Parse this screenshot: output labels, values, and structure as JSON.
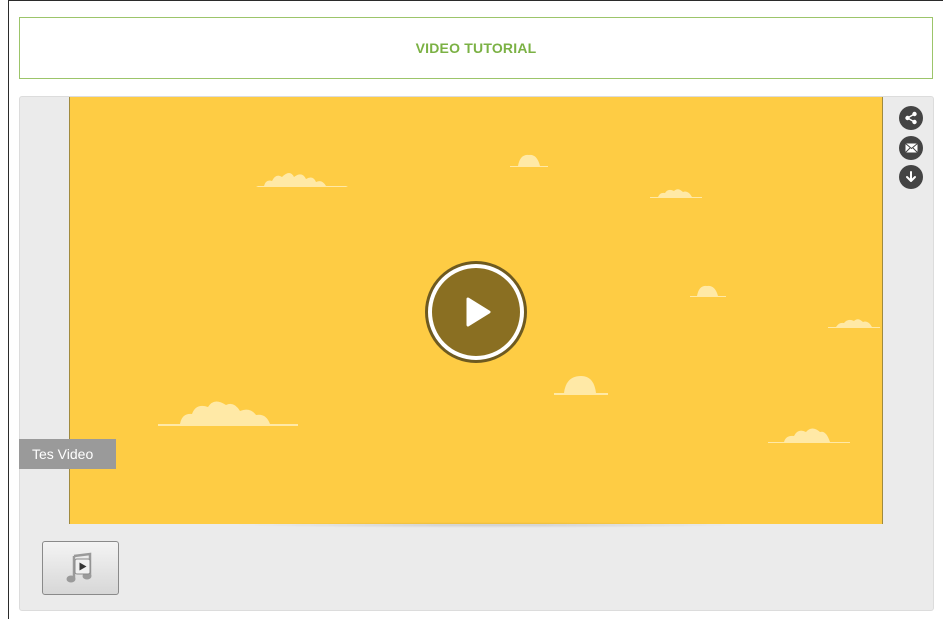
{
  "header": {
    "title": "VIDEO TUTORIAL"
  },
  "player": {
    "caption": "Tes Video",
    "play_icon": "play-icon",
    "side_actions": [
      {
        "name": "share",
        "icon": "share-icon"
      },
      {
        "name": "email",
        "icon": "mail-icon"
      },
      {
        "name": "download",
        "icon": "download-icon"
      }
    ],
    "media_button_icon": "music-play-icon"
  },
  "colors": {
    "accent_green": "#7bb144",
    "video_background": "#fecc44",
    "cloud": "#ffe9a6",
    "play_disc": "#8a6f22",
    "panel": "#ebebeb",
    "caption_bg": "#9a9a9a"
  }
}
